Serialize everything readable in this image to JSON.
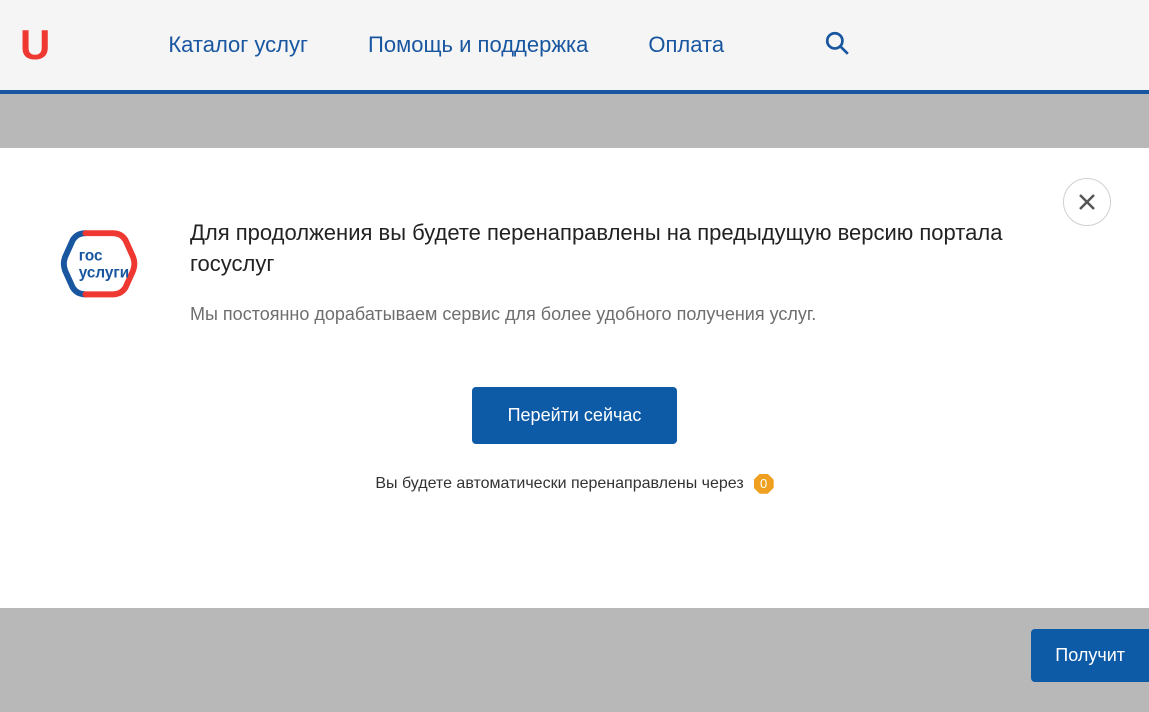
{
  "header": {
    "logo_fragment": "U",
    "nav": {
      "catalog": "Каталог услуг",
      "help": "Помощь и поддержка",
      "payment": "Оплата"
    }
  },
  "modal": {
    "logo_text_top": "гос",
    "logo_text_bottom": "услуги",
    "title": "Для продолжения вы будете перенаправлены на предыдущую версию портала госуслуг",
    "subtitle": "Мы постоянно дорабатываем сервис для более удобного получения услуг.",
    "primary_button": "Перейти сейчас",
    "redirect_text": "Вы будете автоматически перенаправлены через",
    "countdown": "0"
  },
  "bottom_button": "Получит"
}
